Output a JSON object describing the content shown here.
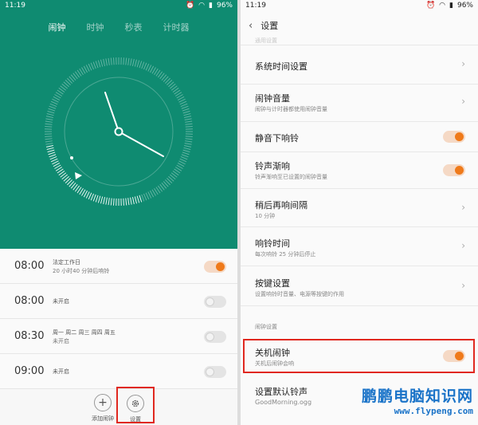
{
  "left": {
    "statusbar": {
      "time": "11:19",
      "battery": "96%"
    },
    "tabs": [
      "闹钟",
      "时钟",
      "秒表",
      "计时器"
    ],
    "accent": "#0f8b71",
    "alarms": [
      {
        "time": "08:00",
        "label": "法定工作日",
        "sub": "20 小时40 分钟后响铃",
        "on": true
      },
      {
        "time": "08:00",
        "label": "未开启",
        "sub": "",
        "on": false
      },
      {
        "time": "08:30",
        "label": "周一 周二 周三 周四 周五",
        "sub": "未开启",
        "on": false
      },
      {
        "time": "09:00",
        "label": "未开启",
        "sub": "",
        "on": false
      }
    ],
    "actions": {
      "add": "添加闹钟",
      "settings": "设置"
    }
  },
  "right": {
    "statusbar": {
      "time": "11:19",
      "battery": "96%"
    },
    "title": "设置",
    "partial_top": "通用设置",
    "settings": [
      {
        "title": "系统时间设置",
        "sub": "",
        "control": "chevron"
      },
      {
        "title": "闹钟音量",
        "sub": "闹钟与计时器都使用闹钟音量",
        "control": "chevron"
      },
      {
        "title": "静音下响铃",
        "sub": "",
        "control": "toggle"
      },
      {
        "title": "铃声渐响",
        "sub": "铃声渐响至已设置的闹钟音量",
        "control": "toggle"
      },
      {
        "title": "稍后再响间隔",
        "sub": "10 分钟",
        "control": "chevron"
      },
      {
        "title": "响铃时间",
        "sub": "每次响铃 25 分钟后停止",
        "control": "chevron"
      },
      {
        "title": "按键设置",
        "sub": "设置响铃时音量、电源等按键的作用",
        "control": "chevron"
      }
    ],
    "section_label": "闹钟设置",
    "poweroff": {
      "title": "关机闹钟",
      "sub": "关机后闹钟会响",
      "control": "toggle"
    },
    "ringtone": {
      "title": "设置默认铃声",
      "sub": "GoodMorning.ogg"
    }
  },
  "watermark": {
    "title": "鹏鹏电脑知识网",
    "url": "www.flypeng.com"
  },
  "colors": {
    "toggle_on": "#ef7a1a",
    "highlight": "#e0281f"
  }
}
